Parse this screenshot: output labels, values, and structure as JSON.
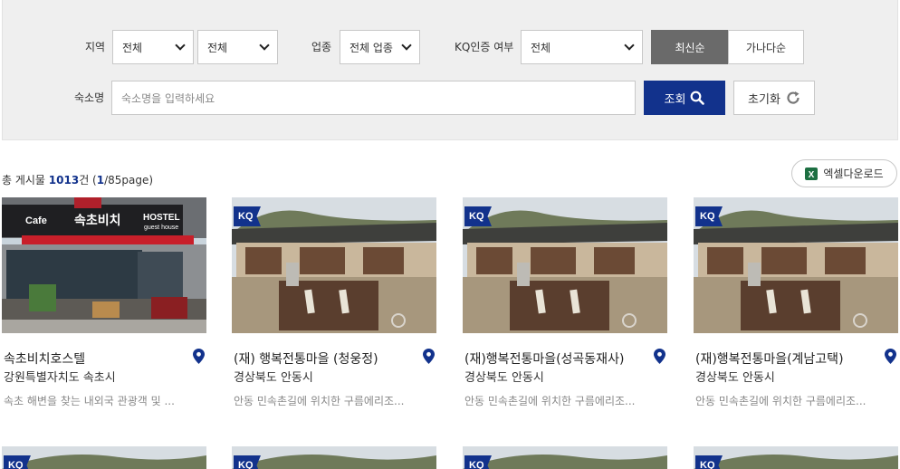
{
  "filters": {
    "region_label": "지역",
    "region1_value": "전체",
    "region2_value": "전체",
    "business_label": "업종",
    "business_value": "전체 업종",
    "kq_label": "KQ인증 여부",
    "kq_value": "전체",
    "sort_latest": "최신순",
    "sort_alpha": "가나다순",
    "name_label": "숙소명",
    "name_placeholder": "숙소명을 입력하세요",
    "search_label": "조회",
    "reset_label": "초기화"
  },
  "summary": {
    "prefix": "총 게시물 ",
    "count": "1013",
    "suffix_unit": "건 (",
    "page_current": "1",
    "page_total": "/85page)",
    "excel_label": "엑셀다운로드"
  },
  "cards": [
    {
      "title": "속초비치호스텔",
      "region": "강원특별자치도 속초시",
      "desc": "속초 해변을 찾는 내외국 관광객 및 ...",
      "kq": "",
      "sign_cafe": "Cafe",
      "sign_main": "속초비치",
      "sign_hostel": "HOSTEL",
      "sign_guest": "guest house"
    },
    {
      "title": "(재) 행복전통마을 (청웅정)",
      "region": "경상북도 안동시",
      "desc": "안동 민속촌길에 위치한 구름에리조...",
      "kq": "KQ"
    },
    {
      "title": "(재)행복전통마을(성곡동재사)",
      "region": "경상북도 안동시",
      "desc": "안동 민속촌길에 위치한 구름에리조...",
      "kq": "KQ"
    },
    {
      "title": "(재)행복전통마을(계남고택)",
      "region": "경상북도 안동시",
      "desc": "안동 민속촌길에 위치한 구름에리조...",
      "kq": "KQ"
    }
  ],
  "next_row": [
    {
      "kq": "KQ"
    },
    {
      "kq": "KQ"
    },
    {
      "kq": "KQ"
    },
    {
      "kq": "KQ"
    }
  ],
  "colors": {
    "primary": "#12328c",
    "sort_active": "#6a6a6a",
    "filter_bg": "#efefef"
  },
  "icons": {
    "search": "search-icon",
    "reset": "refresh-icon",
    "excel": "excel-icon",
    "location": "map-pin-icon"
  }
}
